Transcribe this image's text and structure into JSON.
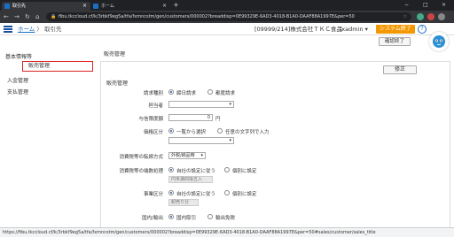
{
  "browser": {
    "tabs": [
      {
        "label": "取引先",
        "active": true
      },
      {
        "label": "ホーム",
        "active": false
      }
    ],
    "new_tab": "+",
    "url": "fibu.tkccloud.cf/k/3rbkf9eg5a/tfa/fxmncstm/gen/customers/000002?breaddisp=0E99329E-6AD3-4018-B1A0-DAAF88A1997E&per=50",
    "window_controls": [
      "−",
      "□",
      "×"
    ]
  },
  "header": {
    "breadcrumb_home": "ホーム",
    "breadcrumb_sep": "〉",
    "breadcrumb_current": "取引先",
    "company": "[09999/214]株式会社ＴＫＣ食品",
    "user": "fxadmin",
    "user_caret": "▾",
    "system_end": "システム終了",
    "help": "?",
    "confirm_end": "確認終了"
  },
  "sidebar": {
    "items": [
      {
        "label": "基本情報等",
        "selected": false
      },
      {
        "label": "販売管理",
        "selected": true
      },
      {
        "label": "入金管理",
        "selected": false
      },
      {
        "label": "支払管理",
        "selected": false
      }
    ]
  },
  "main": {
    "title": "販売管理",
    "fix_button": "修正",
    "section": "販売管理",
    "fields": {
      "billing_type": {
        "label": "請求種別",
        "options": [
          "締日請求",
          "都度請求"
        ],
        "selected": 0
      },
      "person": {
        "label": "担当者",
        "value": ""
      },
      "credit_limit": {
        "label": "与信限度額",
        "value": "0",
        "unit": "円"
      },
      "price_category": {
        "label": "価格区分",
        "options": [
          "一覧から選択",
          "任意の文字列で入力"
        ],
        "selected": 0,
        "select_value": ""
      },
      "tax_method": {
        "label": "消費税等の転嫁方式",
        "value": "外税/納品時"
      },
      "tax_rounding": {
        "label": "消費税等の端数処理",
        "options": [
          "自社の設定に従う",
          "個別に設定"
        ],
        "selected": 0,
        "select_value": "円未満四捨五入"
      },
      "item_category": {
        "label": "事業区分",
        "options": [
          "自社の設定に従う",
          "個別に設定"
        ],
        "selected": 0,
        "select_value": "卸売り分"
      },
      "domestic_export": {
        "label": "国内/輸出",
        "options": [
          "国内取引",
          "輸出免税"
        ],
        "selected": 0
      }
    }
  },
  "status_bar": "https://fibu.tkccloud.cf/k/3rbkf9eg5a/tfa/fxmncstm/gen/customers/000002?breaddisp=0E99329E-6AD3-4018-B1A0-DAAF88A1997E&per=50#sales/customer/sales_title"
}
